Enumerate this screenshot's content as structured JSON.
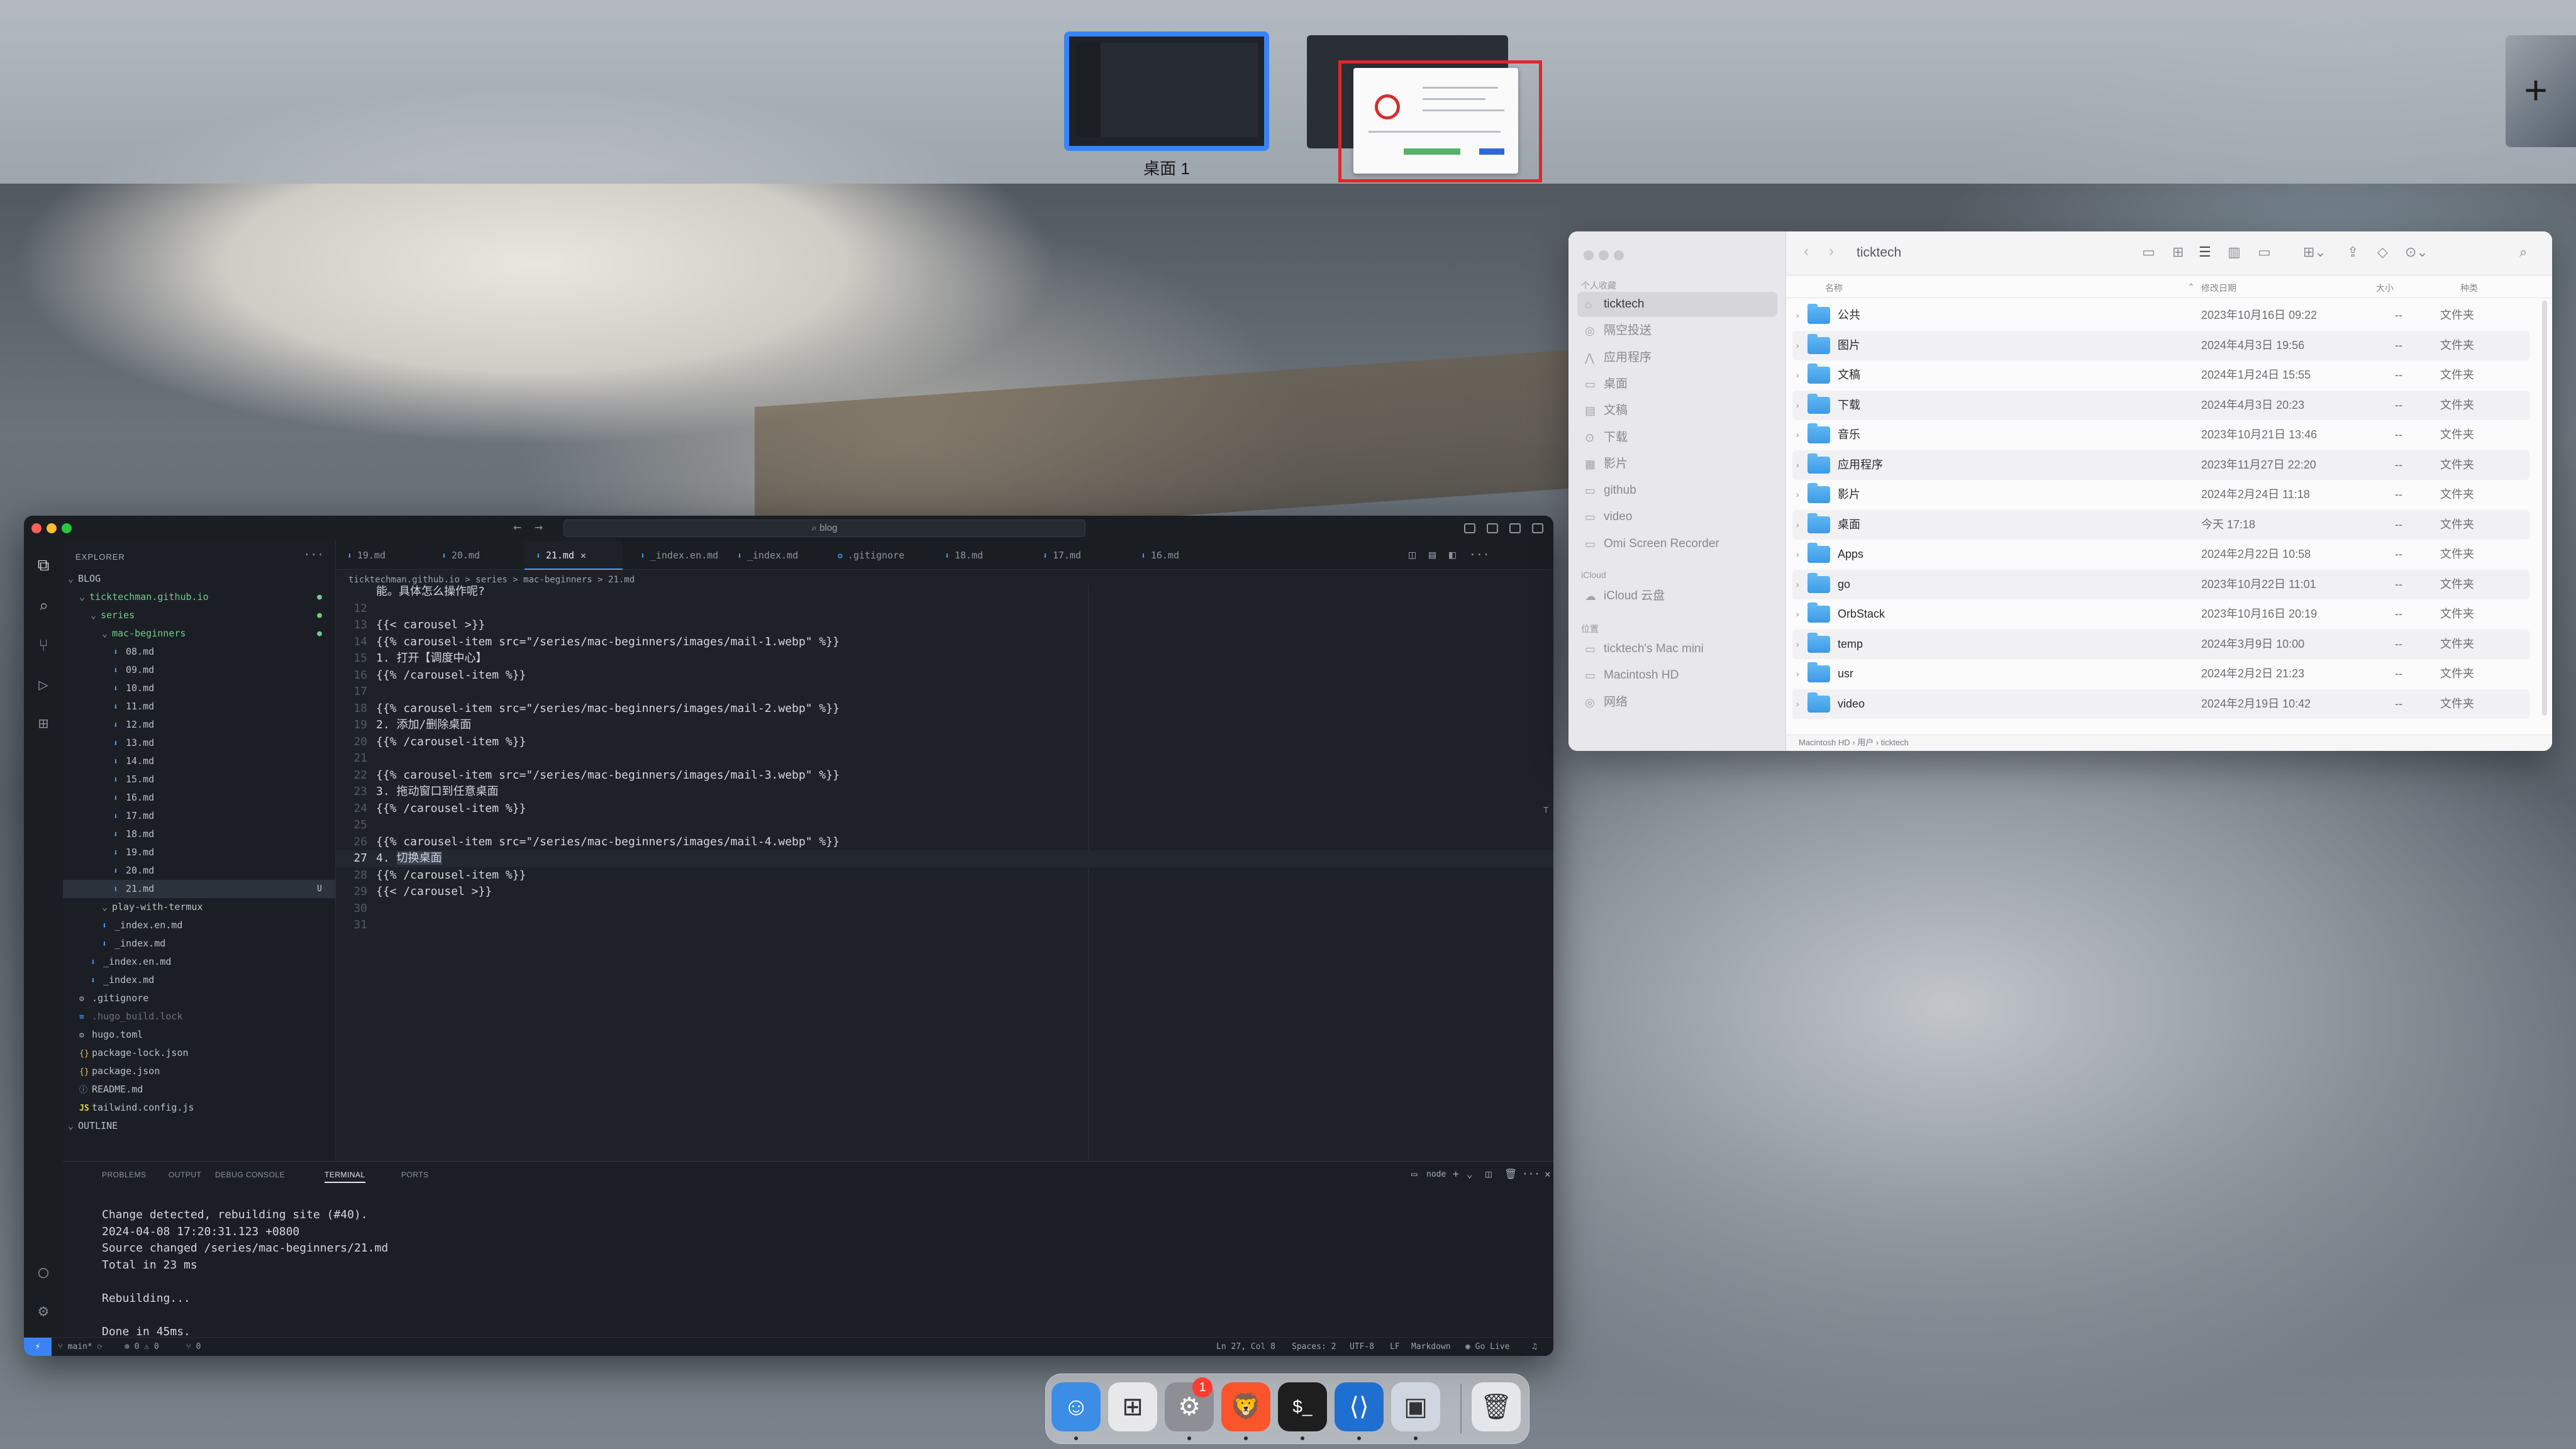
{
  "mission_control": {
    "space_label": "桌面 1",
    "add_space": "+"
  },
  "vscode": {
    "search": "blog",
    "explorer_title": "EXPLORER",
    "tree": [
      {
        "label": "BLOG",
        "kind": "root"
      },
      {
        "label": "ticktechman.github.io",
        "kind": "folder"
      },
      {
        "label": "series",
        "kind": "folder"
      },
      {
        "label": "mac-beginners",
        "kind": "folder"
      },
      {
        "label": "08.md",
        "kind": "md"
      },
      {
        "label": "09.md",
        "kind": "md"
      },
      {
        "label": "10.md",
        "kind": "md"
      },
      {
        "label": "11.md",
        "kind": "md"
      },
      {
        "label": "12.md",
        "kind": "md"
      },
      {
        "label": "13.md",
        "kind": "md"
      },
      {
        "label": "14.md",
        "kind": "md"
      },
      {
        "label": "15.md",
        "kind": "md"
      },
      {
        "label": "16.md",
        "kind": "md"
      },
      {
        "label": "17.md",
        "kind": "md"
      },
      {
        "label": "18.md",
        "kind": "md"
      },
      {
        "label": "19.md",
        "kind": "md"
      },
      {
        "label": "20.md",
        "kind": "md"
      },
      {
        "label": "21.md",
        "kind": "md",
        "mod": "U"
      },
      {
        "label": "play-with-termux",
        "kind": "folder"
      },
      {
        "label": "_index.en.md",
        "kind": "md"
      },
      {
        "label": "_index.md",
        "kind": "md"
      },
      {
        "label": "_index.en.md",
        "kind": "md"
      },
      {
        "label": "_index.md",
        "kind": "md"
      },
      {
        "label": ".gitignore",
        "kind": "gear"
      },
      {
        "label": ".hugo_build.lock",
        "kind": "plain"
      },
      {
        "label": "hugo.toml",
        "kind": "gear"
      },
      {
        "label": "package-lock.json",
        "kind": "json"
      },
      {
        "label": "package.json",
        "kind": "json"
      },
      {
        "label": "README.md",
        "kind": "info"
      },
      {
        "label": "tailwind.config.js",
        "kind": "js"
      },
      {
        "label": "OUTLINE",
        "kind": "root"
      }
    ],
    "tabs": [
      "19.md",
      "20.md",
      "21.md",
      "_index.en.md",
      "_index.md",
      ".gitignore",
      "18.md",
      "17.md",
      "16.md"
    ],
    "tab_close": "✕",
    "breadcrumb": "ticktechman.github.io > series > mac-beginners > 21.md",
    "code_lines": [
      {
        "n": "",
        "t": "能。具体怎么操作呢?"
      },
      {
        "n": "12",
        "t": ""
      },
      {
        "n": "13",
        "t": "{{< carousel >}}"
      },
      {
        "n": "14",
        "t": "{{% carousel-item src=\"/series/mac-beginners/images/mail-1.webp\" %}}"
      },
      {
        "n": "15",
        "t": "1. 打开【调度中心】"
      },
      {
        "n": "16",
        "t": "{{% /carousel-item %}}"
      },
      {
        "n": "17",
        "t": ""
      },
      {
        "n": "18",
        "t": "{{% carousel-item src=\"/series/mac-beginners/images/mail-2.webp\" %}}"
      },
      {
        "n": "19",
        "t": "2. 添加/删除桌面"
      },
      {
        "n": "20",
        "t": "{{% /carousel-item %}}"
      },
      {
        "n": "21",
        "t": ""
      },
      {
        "n": "22",
        "t": "{{% carousel-item src=\"/series/mac-beginners/images/mail-3.webp\" %}}"
      },
      {
        "n": "23",
        "t": "3. 拖动窗口到任意桌面"
      },
      {
        "n": "24",
        "t": "{{% /carousel-item %}}"
      },
      {
        "n": "25",
        "t": ""
      },
      {
        "n": "26",
        "t": "{{% carousel-item src=\"/series/mac-beginners/images/mail-4.webp\" %}}"
      },
      {
        "n": "27",
        "t": "4. 切换桌面"
      },
      {
        "n": "28",
        "t": "{{% /carousel-item %}}"
      },
      {
        "n": "29",
        "t": "{{< /carousel >}}"
      },
      {
        "n": "30",
        "t": ""
      },
      {
        "n": "31",
        "t": ""
      }
    ],
    "panel_tabs": [
      "PROBLEMS",
      "OUTPUT",
      "DEBUG CONSOLE",
      "TERMINAL",
      "PORTS"
    ],
    "terminal_name": "node",
    "terminal_lines": [
      "Change detected, rebuilding site (#40).",
      "2024-04-08 17:20:31.123 +0800",
      "Source changed /series/mac-beginners/21.md",
      "Total in 23 ms",
      "",
      "Rebuilding...",
      "",
      "Done in 45ms."
    ],
    "status": {
      "branch": "main*",
      "errors": "⊗ 0 ⚠ 0",
      "ports": "⑂ 0",
      "position": "Ln 27, Col 8",
      "spaces": "Spaces: 2",
      "encoding": "UTF-8",
      "eol": "LF",
      "language": "Markdown",
      "golive": "Go Live"
    }
  },
  "finder": {
    "title": "ticktech",
    "sidebar": {
      "favorites_title": "个人收藏",
      "favorites": [
        "ticktech",
        "隔空投送",
        "应用程序",
        "桌面",
        "文稿",
        "下载",
        "影片",
        "github",
        "video",
        "Omi Screen Recorder"
      ],
      "icloud_title": "iCloud",
      "icloud": [
        "iCloud 云盘"
      ],
      "locations_title": "位置",
      "locations": [
        "ticktech's Mac mini",
        "Macintosh HD",
        "网络"
      ]
    },
    "columns": {
      "name": "名称",
      "date": "修改日期",
      "size": "大小",
      "kind": "种类"
    },
    "rows": [
      {
        "name": "公共",
        "date": "2023年10月16日 09:22",
        "size": "--",
        "kind": "文件夹"
      },
      {
        "name": "图片",
        "date": "2024年4月3日 19:56",
        "size": "--",
        "kind": "文件夹"
      },
      {
        "name": "文稿",
        "date": "2024年1月24日 15:55",
        "size": "--",
        "kind": "文件夹"
      },
      {
        "name": "下载",
        "date": "2024年4月3日 20:23",
        "size": "--",
        "kind": "文件夹"
      },
      {
        "name": "音乐",
        "date": "2023年10月21日 13:46",
        "size": "--",
        "kind": "文件夹"
      },
      {
        "name": "应用程序",
        "date": "2023年11月27日 22:20",
        "size": "--",
        "kind": "文件夹"
      },
      {
        "name": "影片",
        "date": "2024年2月24日 11:18",
        "size": "--",
        "kind": "文件夹"
      },
      {
        "name": "桌面",
        "date": "今天 17:18",
        "size": "--",
        "kind": "文件夹"
      },
      {
        "name": "Apps",
        "date": "2024年2月22日 10:58",
        "size": "--",
        "kind": "文件夹"
      },
      {
        "name": "go",
        "date": "2023年10月22日 11:01",
        "size": "--",
        "kind": "文件夹"
      },
      {
        "name": "OrbStack",
        "date": "2023年10月16日 20:19",
        "size": "--",
        "kind": "文件夹"
      },
      {
        "name": "temp",
        "date": "2024年3月9日 10:00",
        "size": "--",
        "kind": "文件夹"
      },
      {
        "name": "usr",
        "date": "2024年2月2日 21:23",
        "size": "--",
        "kind": "文件夹"
      },
      {
        "name": "video",
        "date": "2024年2月19日 10:42",
        "size": "--",
        "kind": "文件夹"
      }
    ],
    "path": "Macintosh HD › 用户 › ticktech"
  },
  "dock": {
    "apps": [
      {
        "name": "Finder",
        "icon": "finder-icon",
        "color": "#3b8de6"
      },
      {
        "name": "Launchpad",
        "icon": "launchpad-icon",
        "color": "#e8e8ea"
      },
      {
        "name": "System Settings",
        "icon": "settings-icon",
        "color": "#8d8f94"
      },
      {
        "name": "Brave",
        "icon": "brave-icon",
        "color": "#fb542b"
      },
      {
        "name": "Terminal",
        "icon": "terminal-icon",
        "color": "#1e1e1e"
      },
      {
        "name": "Visual Studio Code",
        "icon": "vscode-icon",
        "color": "#1f6fd0"
      },
      {
        "name": "Preview",
        "icon": "preview-icon",
        "color": "#cfd6df"
      },
      {
        "name": "Trash",
        "icon": "trash-icon",
        "color": "#e4e6ea"
      }
    ],
    "settings_badge": "1"
  }
}
